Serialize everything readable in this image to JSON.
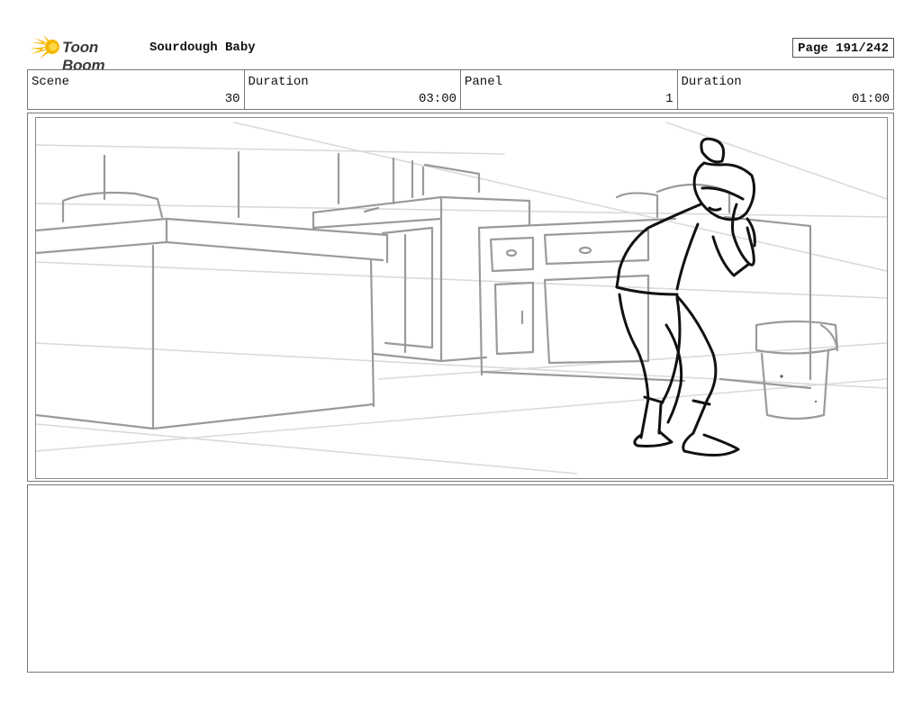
{
  "header": {
    "logo_text": "Toon Boom",
    "project_title": "Sourdough Baby",
    "page_label": "Page 191/242"
  },
  "info": {
    "scene_label": "Scene",
    "scene_value": "30",
    "scene_duration_label": "Duration",
    "scene_duration_value": "03:00",
    "panel_label": "Panel",
    "panel_value": "1",
    "panel_duration_label": "Duration",
    "panel_duration_value": "01:00"
  },
  "colors": {
    "logo_yellow": "#f5b800",
    "sketch_grey": "#9a9a9a",
    "character_ink": "#111111"
  },
  "notes": {
    "text": ""
  }
}
